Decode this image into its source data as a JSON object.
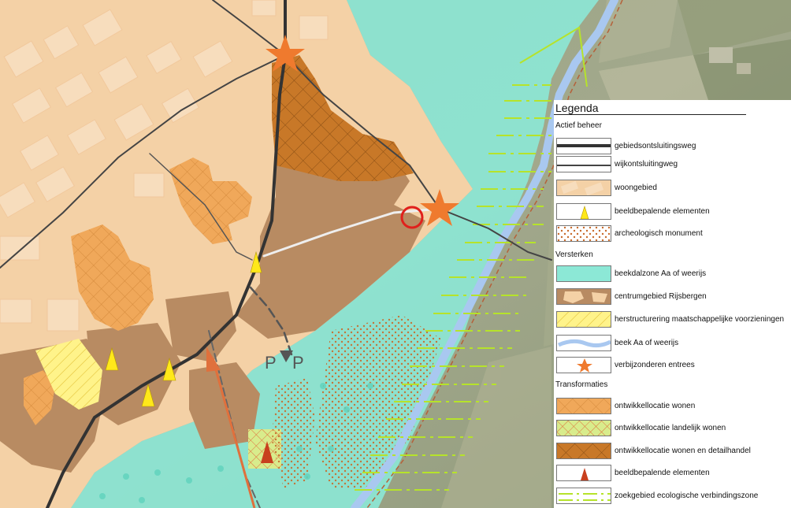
{
  "legend": {
    "title": "Legenda",
    "sections": [
      {
        "heading": "Actief beheer",
        "items": [
          {
            "label": "gebiedsontsluitingsweg",
            "swatch": "road-thick-icon"
          },
          {
            "label": "wijkontsluitingweg",
            "swatch": "road-thin-icon"
          },
          {
            "label": "woongebied",
            "swatch": "residential-fill"
          },
          {
            "label": "beeldbepalende elementen",
            "swatch": "yellow-triangle-icon"
          },
          {
            "label": "archeologisch monument",
            "swatch": "dot-pattern-fill"
          }
        ]
      },
      {
        "heading": "Versterken",
        "items": [
          {
            "label": "beekdalzone Aa of weerijs",
            "swatch": "mint-fill"
          },
          {
            "label": "centrumgebied Rijsbergen",
            "swatch": "brown-blocks-fill"
          },
          {
            "label": "herstructurering maatschappelijke voorzieningen",
            "swatch": "yellow-hatch-fill"
          },
          {
            "label": "beek Aa of weerijs",
            "swatch": "stream-line-icon"
          },
          {
            "label": "verbijzonderen entrees",
            "swatch": "orange-star-icon"
          }
        ]
      },
      {
        "heading": "Transformaties",
        "items": [
          {
            "label": "ontwikkellocatie wonen",
            "swatch": "orange-grid-fill"
          },
          {
            "label": "ontwikkellocatie landelijk wonen",
            "swatch": "green-grid-fill"
          },
          {
            "label": "ontwikkellocatie wonen en detailhandel",
            "swatch": "brown-grid-fill"
          },
          {
            "label": "beeldbepalende elementen",
            "swatch": "red-triangle-icon"
          },
          {
            "label": "zoekgebied ecologische verbindingszone",
            "swatch": "green-dash-line-icon"
          }
        ]
      }
    ]
  },
  "map_labels": {
    "parking_1": "P",
    "parking_2": "P"
  },
  "colors": {
    "residential": "#f4d1a6",
    "centrum": "#b88b62",
    "mint": "#8ce8d6",
    "orange_dev": "#f0a85a",
    "brown_dev": "#c87828",
    "yellow_hatch": "#fff38a",
    "stream": "#a9c8f0",
    "star": "#ef7a2e",
    "eco_line": "#b6e32a"
  }
}
